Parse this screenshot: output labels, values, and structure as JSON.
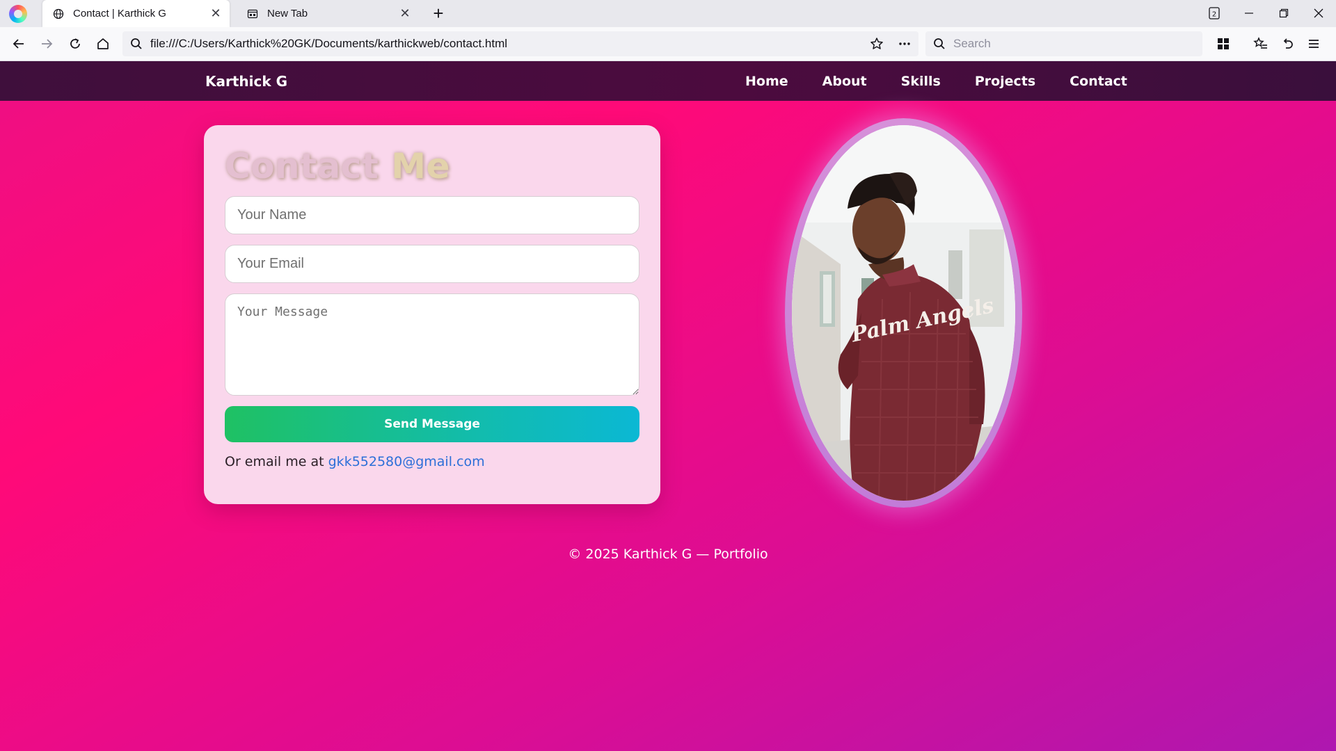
{
  "browser": {
    "tabs": [
      {
        "title": "Contact | Karthick G",
        "icon": "globe-icon",
        "active": true
      },
      {
        "title": "New Tab",
        "icon": "newtab-icon",
        "active": false
      }
    ],
    "tab_count": "2",
    "url": "file:///C:/Users/Karthick%20GK/Documents/karthickweb/contact.html",
    "search_placeholder": "Search"
  },
  "site": {
    "brand": "Karthick G",
    "nav": [
      "Home",
      "About",
      "Skills",
      "Projects",
      "Contact"
    ]
  },
  "contact": {
    "title_part1": "Contact",
    "title_part2": "Me",
    "name_placeholder": "Your Name",
    "email_placeholder": "Your Email",
    "message_placeholder": "Your Message",
    "send_label": "Send Message",
    "email_note": "Or email me at",
    "email_address": "gkk552580@gmail.com"
  },
  "portrait": {
    "shirt_text": "Palm Angels"
  },
  "footer": {
    "text": "© 2025 Karthick G — Portfolio"
  },
  "colors": {
    "page_gradient_start": "#ff0a78",
    "page_gradient_end": "#ae17b0",
    "nav_background": "#4c0b3e",
    "card_background": "#fad7ec",
    "button_gradient_start": "#1fc163",
    "button_gradient_end": "#0bb8d4",
    "link": "#2c6fd8"
  }
}
